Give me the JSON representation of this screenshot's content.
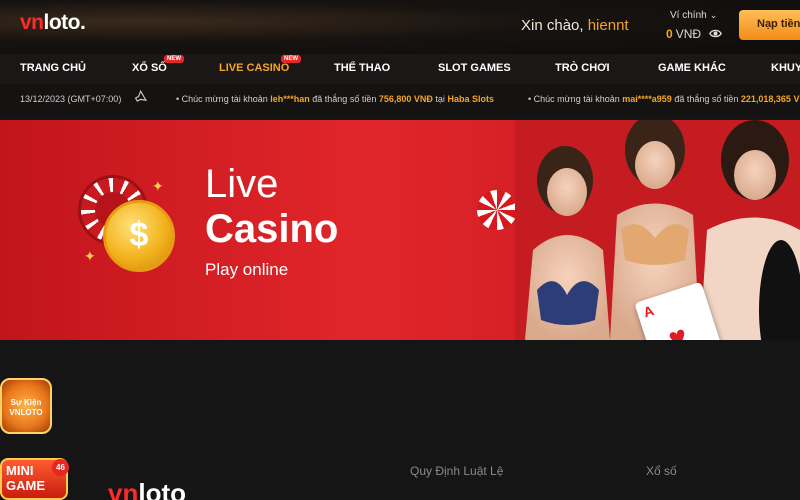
{
  "header": {
    "logo_vn": "vn",
    "logo_rest": "loto.",
    "greeting": "Xin chào,",
    "username": "hiennt",
    "wallet_label": "Ví chính",
    "balance": "0",
    "currency": "VNĐ",
    "deposit_label": "Nạp tiền"
  },
  "nav": {
    "items": [
      {
        "label": "TRANG CHỦ"
      },
      {
        "label": "XỔ SỐ",
        "badge": "NEW"
      },
      {
        "label": "LIVE CASINO",
        "badge": "NEW"
      },
      {
        "label": "THỂ THAO"
      },
      {
        "label": "SLOT GAMES"
      },
      {
        "label": "TRÒ CHƠI"
      },
      {
        "label": "GAME KHÁC"
      },
      {
        "label": "KHUY"
      }
    ]
  },
  "ticker": {
    "date": "13/12/2023 (GMT+07:00)",
    "messages": [
      {
        "prefix": "• Chúc mừng tài khoản",
        "user": "leh***han",
        "mid": "đã thắng số tiền",
        "amount": "756,800 VNĐ",
        "at": "tại",
        "game": "Haba Slots"
      },
      {
        "prefix": "• Chúc mừng tài khoản",
        "user": "mai****a959",
        "mid": "đã thắng số tiền",
        "amount": "221,018,365 V",
        "at": "",
        "game": ""
      }
    ]
  },
  "banner": {
    "title_line1": "Live",
    "title_line2": "Casino",
    "subtitle": "Play online",
    "coin_symbol": "$"
  },
  "badges": {
    "event_line1": "Sự Kiện",
    "event_line2": "VNLOTO",
    "minigame_line1": "MINI",
    "minigame_line2": "GAME",
    "minigame_count": "46"
  },
  "footer": {
    "logo_vn": "vn",
    "logo_rest": "loto",
    "links": [
      "Quy Định Luật Lệ",
      "Xổ số"
    ]
  },
  "colors": {
    "accent": "#f5a524",
    "brand_red": "#ff2b2b",
    "banner_red": "#e0262a"
  }
}
